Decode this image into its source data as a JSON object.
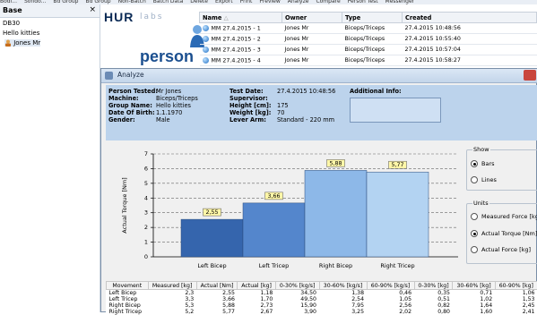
{
  "menu_strip": [
    "Bodi...",
    "Sondo...",
    "Bd Group",
    "Bd Group",
    "Non-Batch",
    "Batch Data",
    "Delete",
    "Export",
    "Print",
    "Preview",
    "Analyze",
    "Compare",
    "Person Test",
    "Messenger"
  ],
  "left_pane": {
    "header": "Base",
    "close_symbol": "×",
    "items": [
      {
        "label": "DB30",
        "icon": ""
      },
      {
        "label": "Hello kitties",
        "icon": ""
      },
      {
        "label": "Jones Mr",
        "icon": "person-icon"
      }
    ]
  },
  "logo": {
    "hur": "HUR",
    "labs": "labs",
    "person": "person"
  },
  "test_list": {
    "columns": [
      "Name",
      "Owner",
      "Type",
      "Created"
    ],
    "sort_glyph": "△",
    "rows": [
      {
        "name": "MM 27.4.2015 - 1",
        "owner": "Jones Mr",
        "type": "Biceps/Triceps",
        "created": "27.4.2015 10:48:56"
      },
      {
        "name": "MM 27.4.2015 - 2",
        "owner": "Jones Mr",
        "type": "Biceps/Triceps",
        "created": "27.4.2015 10:55:40"
      },
      {
        "name": "MM 27.4.2015 - 3",
        "owner": "Jones Mr",
        "type": "Biceps/Triceps",
        "created": "27.4.2015 10:57:04"
      },
      {
        "name": "MM 27.4.2015 - 4",
        "owner": "Jones Mr",
        "type": "Biceps/Triceps",
        "created": "27.4.2015 10:58:27"
      }
    ]
  },
  "window": {
    "title": "Analyze",
    "info": {
      "person_tested_label": "Person Tested:",
      "person_tested": "Mr Jones",
      "machine_label": "Machine:",
      "machine": "Biceps/Triceps",
      "group_label": "Group Name:",
      "group": "Hello kitties",
      "dob_label": "Date Of Birth:",
      "dob": "1.1.1970",
      "gender_label": "Gender:",
      "gender": "Male",
      "test_date_label": "Test Date:",
      "test_date": "27.4.2015 10:48:56",
      "supervisor_label": "Supervisor:",
      "supervisor": "",
      "height_label": "Height [cm]:",
      "height": "175",
      "weight_label": "Weight [kg]:",
      "weight": "70",
      "lever_label": "Lever Arm:",
      "lever": "Standard - 220 mm",
      "additional_label": "Additional Info:"
    },
    "show_group": {
      "title": "Show",
      "options": [
        {
          "label": "Bars",
          "selected": true
        },
        {
          "label": "Lines",
          "selected": false
        }
      ]
    },
    "units_group": {
      "title": "Units",
      "options": [
        {
          "label": "Measured Force [kg]",
          "selected": false
        },
        {
          "label": "Actual Torque [Nm]",
          "selected": true
        },
        {
          "label": "Actual Force [kg]",
          "selected": false
        }
      ]
    },
    "table": {
      "columns": [
        "Movement",
        "Measured [kg]",
        "Actual [Nm]",
        "Actual [kg]",
        "0-30% [kg/s]",
        "30-60% [kg/s]",
        "60-90% [kg/s]",
        "0-30% [kg]",
        "30-60% [kg]",
        "60-90% [kg]"
      ],
      "rows": [
        [
          "Left Bicep",
          "2,3",
          "2,55",
          "1,18",
          "34,50",
          "1,38",
          "0,46",
          "0,35",
          "0,71",
          "1,06"
        ],
        [
          "Left Tricep",
          "3,3",
          "3,66",
          "1,70",
          "49,50",
          "2,54",
          "1,05",
          "0,51",
          "1,02",
          "1,53"
        ],
        [
          "Right Bicep",
          "5,3",
          "5,88",
          "2,73",
          "15,90",
          "7,95",
          "2,56",
          "0,82",
          "1,64",
          "2,45"
        ],
        [
          "Right Tricep",
          "5,2",
          "5,77",
          "2,67",
          "3,90",
          "3,25",
          "2,02",
          "0,80",
          "1,60",
          "2,41"
        ]
      ]
    }
  },
  "chart_data": {
    "type": "bar",
    "categories": [
      "Left Bicep",
      "Left Tricep",
      "Right Bicep",
      "Right Tricep"
    ],
    "values": [
      2.55,
      3.66,
      5.88,
      5.77
    ],
    "data_labels": [
      "2,55",
      "3,66",
      "5,88",
      "5,77"
    ],
    "ylabel": "Actual Torque [Nm]",
    "ylim": [
      0,
      7
    ],
    "yticks": [
      "0",
      "1",
      "2",
      "3",
      "4",
      "5",
      "6",
      "7"
    ],
    "grid": true,
    "colors": [
      "#3565ad",
      "#5486cc",
      "#8db8e8",
      "#b3d3f2"
    ],
    "label_bg": "#fff7a8"
  }
}
